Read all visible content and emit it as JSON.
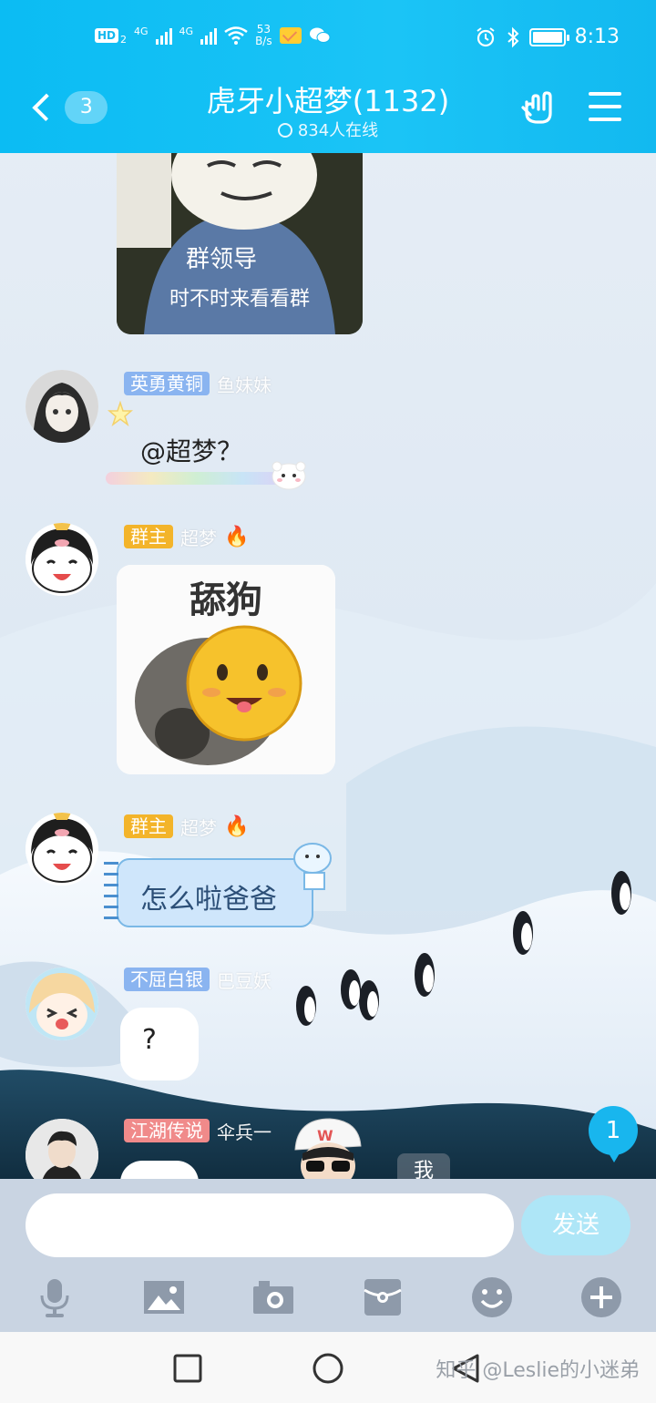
{
  "status_bar": {
    "hd_label": "HD",
    "hd_sub": "2",
    "net1": "4G",
    "net2": "4G",
    "speed_value": "53",
    "speed_unit": "B/s",
    "time": "8:13"
  },
  "header": {
    "back_count": "3",
    "title": "虎牙小超梦(1132)",
    "online": "834人在线"
  },
  "messages": [
    {
      "badge": "英勇黄铜",
      "badge_color": "#8ab4f0",
      "nick": "鱼妹妹",
      "text": "@超梦？"
    },
    {
      "badge": "群主",
      "badge_color": "#f3b42a",
      "nick": "超梦",
      "sticker_text": "舔狗"
    },
    {
      "badge": "群主",
      "badge_color": "#f3b42a",
      "nick": "超梦",
      "text": "怎么啦爸爸"
    },
    {
      "badge": "不屈白银",
      "badge_color": "#8ab4f0",
      "nick": "巴豆妖",
      "text": "?"
    },
    {
      "badge": "江湖传说",
      "badge_color": "#f08a8a",
      "nick": "伞兵一"
    }
  ],
  "top_sticker": {
    "line1": "群领导",
    "line2": "时不时来看看群"
  },
  "scroll_badge": "1",
  "me_tag": "我",
  "input": {
    "value": "",
    "placeholder": "",
    "send_label": "发送"
  },
  "tools": [
    "mic-icon",
    "image-icon",
    "camera-icon",
    "red-packet-icon",
    "emoji-icon",
    "plus-icon"
  ],
  "nav": {
    "watermark": "知乎 @Leslie的小迷弟"
  },
  "colors": {
    "accent": "#12bcf2",
    "send_disabled": "#aee6f7"
  }
}
